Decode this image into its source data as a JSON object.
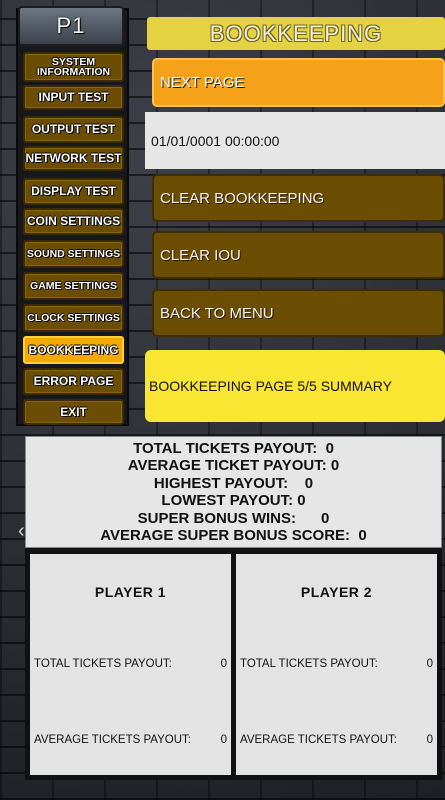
{
  "player_tab": "P1",
  "sidebar": {
    "items": [
      {
        "label": "SYSTEM INFORMATION"
      },
      {
        "label": "INPUT TEST"
      },
      {
        "label": "OUTPUT TEST"
      },
      {
        "label": "NETWORK TEST"
      },
      {
        "label": "DISPLAY TEST"
      },
      {
        "label": "COIN SETTINGS"
      },
      {
        "label": "SOUND SETTINGS"
      },
      {
        "label": "GAME SETTINGS"
      },
      {
        "label": "CLOCK SETTINGS"
      },
      {
        "label": "BOOKKEEPING"
      },
      {
        "label": "ERROR PAGE"
      },
      {
        "label": "EXIT"
      }
    ],
    "active": "BOOKKEEPING"
  },
  "header": {
    "title": "BOOKKEEPING"
  },
  "main": {
    "next_page": "NEXT PAGE",
    "datetime": "01/01/0001 00:00:00",
    "clear_bookkeeping": "CLEAR BOOKKEEPING",
    "clear_iou": "CLEAR IOU",
    "back_to_menu": "BACK TO MENU",
    "page_summary": "BOOKKEEPING PAGE 5/5 SUMMARY"
  },
  "stats": [
    "TOTAL TICKETS PAYOUT:  0",
    "AVERAGE TICKET PAYOUT: 0",
    "HIGHEST PAYOUT:    0",
    "LOWEST PAYOUT: 0",
    "SUPER BONUS WINS:      0",
    "AVERAGE SUPER BONUS SCORE:  0"
  ],
  "players": [
    {
      "title": "PLAYER 1",
      "total_label": "TOTAL TICKETS PAYOUT:",
      "total_value": "0",
      "avg_label": "AVERAGE TICKETS PAYOUT:",
      "avg_value": "0"
    },
    {
      "title": "PLAYER 2",
      "total_label": "TOTAL TICKETS PAYOUT:",
      "total_value": "0",
      "avg_label": "AVERAGE TICKETS PAYOUT:",
      "avg_value": "0"
    }
  ],
  "colors": {
    "button": "#6b4d03",
    "active": "#f2a900",
    "title_bar": "#e5d243",
    "summary": "#f8e632",
    "next_page": "#f5a21a"
  }
}
